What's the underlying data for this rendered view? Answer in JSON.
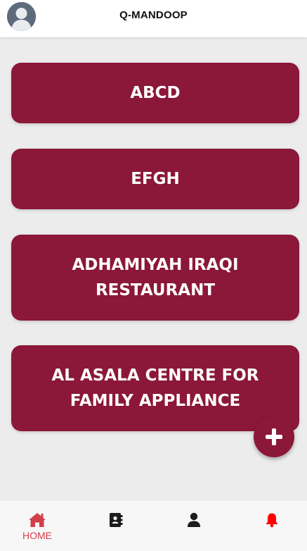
{
  "header": {
    "title": "Q-MANDOOP",
    "avatar_icon": "user-avatar-icon"
  },
  "cards": [
    {
      "label": "ABCD"
    },
    {
      "label": "EFGH"
    },
    {
      "label": "ADHAMIYAH IRAQI RESTAURANT"
    },
    {
      "label": "AL ASALA CENTRE FOR FAMILY APPLIANCE"
    }
  ],
  "fab": {
    "icon": "plus-icon"
  },
  "bottom_nav": {
    "home_label": "HOME",
    "items": [
      "home-icon",
      "contacts-book-icon",
      "user-icon",
      "bell-icon"
    ]
  },
  "colors": {
    "card": "#8b1739",
    "accent": "#d23f4a",
    "bell": "#ff0000",
    "background": "#ececec"
  }
}
